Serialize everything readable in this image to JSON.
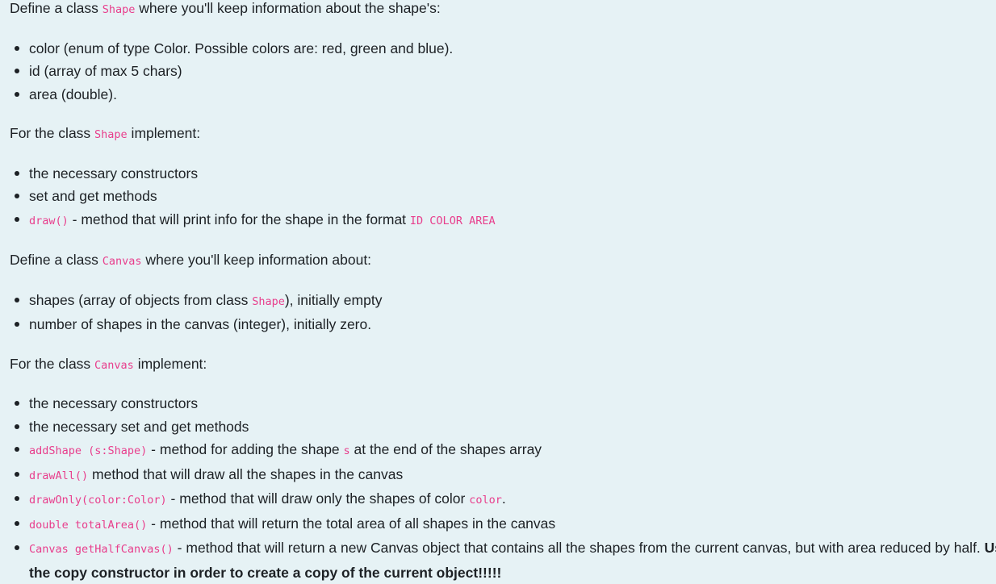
{
  "section1": {
    "intro": {
      "pre": "Define a class ",
      "code": "Shape",
      "post": " where you'll keep information about the shape's:"
    },
    "items": [
      "color (enum of type Color. Possible colors are: red, green and blue).",
      "id (array of max 5 chars)",
      "area (double)."
    ]
  },
  "section2": {
    "intro": {
      "pre": "For the class ",
      "code": "Shape",
      "post": " implement:"
    },
    "items": [
      "the necessary constructors",
      "set and get methods"
    ],
    "draw_item": {
      "code": "draw()",
      "text": " - method that will print info for the shape in the format ",
      "format_code": "ID COLOR AREA"
    }
  },
  "section3": {
    "intro": {
      "pre": "Define a class ",
      "code": "Canvas",
      "post": " where you'll keep information about:"
    },
    "shapes_item": {
      "pre": "shapes (array of objects from class ",
      "code": "Shape",
      "post": "), initially empty"
    },
    "items": [
      "number of shapes in the canvas (integer), initially zero."
    ]
  },
  "section4": {
    "intro": {
      "pre": "For the class ",
      "code": "Canvas",
      "post": " implement:"
    },
    "items": [
      "the necessary constructors",
      "the necessary set and get methods"
    ],
    "add_shape": {
      "code": "addShape (s:Shape)",
      "pre": " - method for adding the shape ",
      "param_code": "s",
      "post": " at the end of the shapes array"
    },
    "draw_all": {
      "code": "drawAll()",
      "text": " method that will draw all the shapes in the canvas"
    },
    "draw_only": {
      "code": "drawOnly(color:Color)",
      "pre": " - method that will draw only the shapes of color ",
      "param_code": "color",
      "post": "."
    },
    "total_area": {
      "code": "double totalArea()",
      "text": " - method that will return the total area of all shapes in the canvas"
    },
    "half_canvas": {
      "code": "Canvas getHalfCanvas()",
      "text": " - method that will return a new Canvas object that contains all the shapes from the current canvas, but with area reduced by half. ",
      "bold": "Use the copy constructor in order to create a copy of the current object!!!!!"
    }
  }
}
